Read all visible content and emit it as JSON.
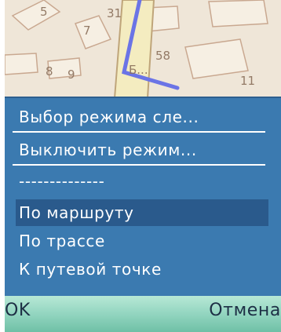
{
  "map": {
    "house_numbers": [
      "5",
      "7",
      "31",
      "58",
      "8",
      "9",
      "11"
    ],
    "street_name": "Б..."
  },
  "menu": {
    "items": [
      {
        "label": "Выбор режима сле..."
      },
      {
        "label": "Выключить режим..."
      },
      {
        "label": "--------------"
      },
      {
        "label": "По маршруту"
      },
      {
        "label": "По трассе"
      },
      {
        "label": "К путевой точке"
      }
    ],
    "selected_index": 3
  },
  "softkeys": {
    "left": "OK",
    "right": "Отмена"
  },
  "colors": {
    "menu_background": "#3b7ab0",
    "menu_selected": "#2a5a8c",
    "route_line": "#6b74e6",
    "softkey_bar": "#8fd3bd"
  }
}
